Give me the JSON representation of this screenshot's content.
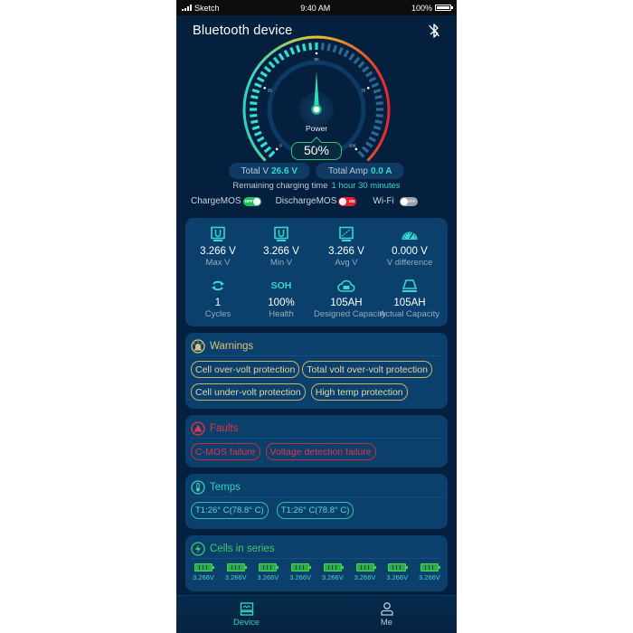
{
  "statusbar": {
    "carrier": "Sketch",
    "time": "9:40 AM",
    "battery": "100%"
  },
  "header": {
    "title": "Bluetooth device",
    "bluetooth_icon": "bluetooth-icon"
  },
  "gauge": {
    "label": "Power",
    "value_text": "50%",
    "value_percent": 50,
    "tick_labels": [
      "0",
      "25",
      "50",
      "75",
      "100"
    ],
    "colors": {
      "active": "#2ee0d0",
      "inactive": "#2b6a94",
      "arc_start": "#26d6c5",
      "arc_mid": "#e6c62a",
      "arc_end": "#e2262f"
    }
  },
  "totals": {
    "total_v_label": "Total V",
    "total_v_value": "26.6 V",
    "total_amp_label": "Total Amp",
    "total_amp_value": "0.0 A"
  },
  "remaining": {
    "label": "Remaining charging time",
    "value": "1 hour 30 minutes"
  },
  "toggles": [
    {
      "label": "ChargeMOS",
      "state_text": "OFF",
      "color": "green"
    },
    {
      "label": "DischargeMOS",
      "state_text": "ON",
      "color": "red"
    },
    {
      "label": "Wi-Fi",
      "state_text": "OFF",
      "color": "grey"
    }
  ],
  "stats": [
    {
      "icon": "voltmeter-icon",
      "value": "3.266 V",
      "label": "Max V"
    },
    {
      "icon": "voltmeter-icon",
      "value": "3.266 V",
      "label": "Min V"
    },
    {
      "icon": "wave-chart-icon",
      "value": "3.266 V",
      "label": "Avg V"
    },
    {
      "icon": "speedometer-icon",
      "value": "0.000 V",
      "label": "V difference"
    },
    {
      "icon": "cycle-icon",
      "value": "1",
      "label": "Cycles"
    },
    {
      "icon": "soh-icon",
      "icon_text": "SOH",
      "value": "100%",
      "label": "Health"
    },
    {
      "icon": "cloud-capacity-icon",
      "value": "105AH",
      "label": "Designed Capacity"
    },
    {
      "icon": "capacity-icon",
      "value": "105AH",
      "label": "Actual Capacity"
    }
  ],
  "warnings": {
    "title": "Warnings",
    "items": [
      "Cell over-volt protection",
      "Total volt over-volt protection",
      "Cell under-volt protection",
      "High temp protection"
    ]
  },
  "faults": {
    "title": "Faults",
    "items": [
      "C-MOS failure",
      "Voltage  detection failure"
    ]
  },
  "temps": {
    "title": "Temps",
    "items": [
      "T1:26° C(78.8° C)",
      "T1:26° C(78.8° C)"
    ]
  },
  "cells": {
    "title": "Cells in series",
    "items": [
      "3.266V",
      "3.266V",
      "3.266V",
      "3.266V",
      "3.266V",
      "3.266V",
      "3.266V",
      "3.266V"
    ]
  },
  "tabbar": [
    {
      "label": "Device",
      "icon": "device-icon",
      "active": true
    },
    {
      "label": "Me",
      "icon": "person-icon",
      "active": false
    }
  ]
}
